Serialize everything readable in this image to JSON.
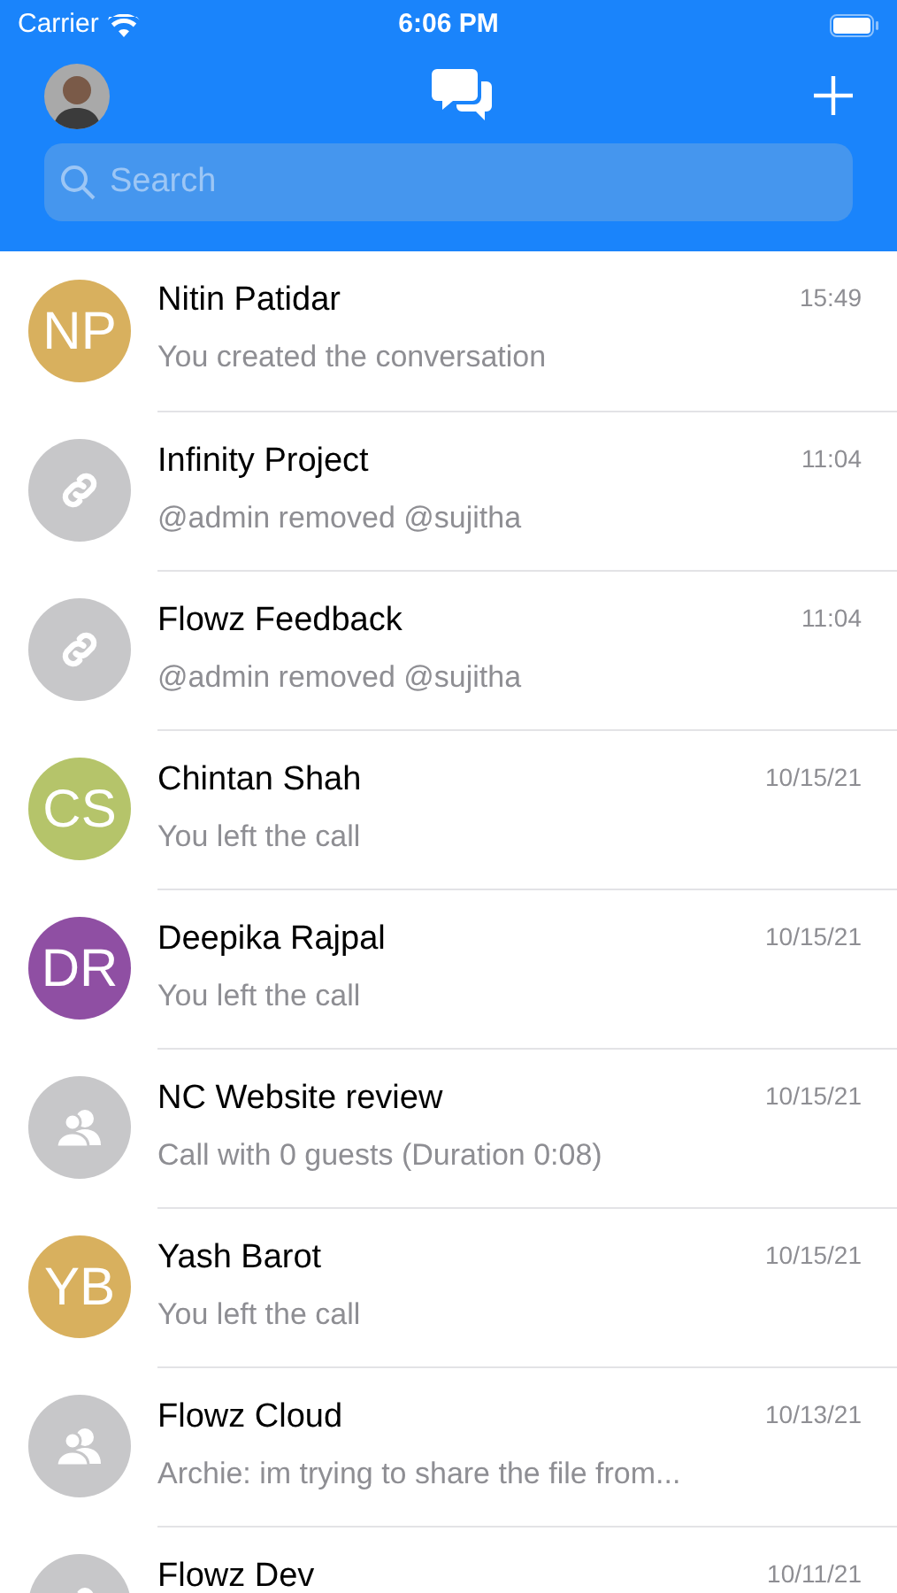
{
  "status_bar": {
    "carrier": "Carrier",
    "time": "6:06 PM"
  },
  "search": {
    "placeholder": "Search"
  },
  "conversations": [
    {
      "name": "Nitin Patidar",
      "time": "15:49",
      "message": "You created the conversation",
      "avatar": {
        "kind": "initials",
        "initials": "NP",
        "color": "#d8b05e"
      }
    },
    {
      "name": "Infinity Project",
      "time": "11:04",
      "message": "@admin removed @sujitha",
      "avatar": {
        "kind": "link"
      }
    },
    {
      "name": "Flowz Feedback",
      "time": "11:04",
      "message": "@admin removed @sujitha",
      "avatar": {
        "kind": "link"
      }
    },
    {
      "name": "Chintan Shah",
      "time": "10/15/21",
      "message": "You left the call",
      "avatar": {
        "kind": "initials",
        "initials": "CS",
        "color": "#b5c46a"
      }
    },
    {
      "name": "Deepika Rajpal",
      "time": "10/15/21",
      "message": "You left the call",
      "avatar": {
        "kind": "initials",
        "initials": "DR",
        "color": "#8f4fa3"
      }
    },
    {
      "name": "NC Website review",
      "time": "10/15/21",
      "message": "Call with 0 guests (Duration 0:08)",
      "avatar": {
        "kind": "group"
      }
    },
    {
      "name": "Yash Barot",
      "time": "10/15/21",
      "message": "You left the call",
      "avatar": {
        "kind": "initials",
        "initials": "YB",
        "color": "#d8b05e"
      }
    },
    {
      "name": "Flowz Cloud",
      "time": "10/13/21",
      "message": "Archie: im trying to share the file from...",
      "avatar": {
        "kind": "group"
      }
    },
    {
      "name": "Flowz Dev",
      "time": "10/11/21",
      "avatar": {
        "kind": "group"
      }
    }
  ]
}
